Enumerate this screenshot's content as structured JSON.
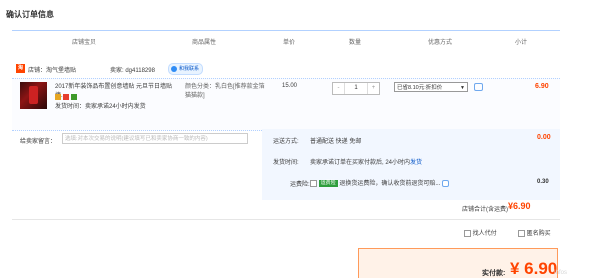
{
  "page": {
    "title": "确认订单信息"
  },
  "columns": [
    "店铺宝贝",
    "商品属性",
    "单价",
    "数量",
    "优惠方式",
    "小计"
  ],
  "shop": {
    "icon_text": "淘",
    "name": "店铺：淘气堡墙贴",
    "seller": "卖家: dg4118298",
    "contact_label": "和我联系"
  },
  "item": {
    "name": "2017新年装饰品布置创意墙贴 元旦节日墙贴墙...",
    "shipping": "发货时间：卖家承诺24小时内发货",
    "sku": "颜色分类：乳白色[推荐款金箔猫猫款]",
    "price": "15.00",
    "quantity": "1",
    "minus": "-",
    "plus": "+",
    "promo": "已省8.10元:折扣价",
    "subtotal": "6.90"
  },
  "message": {
    "label": "给卖家留言：",
    "placeholder": "选填:对本次交易的说明(建议填写已和卖家协商一致的内容)"
  },
  "delivery": {
    "method_label": "运送方式:",
    "method_value": "普通配送 快递 免邮",
    "method_fee": "0.00",
    "time_label": "发货时间:",
    "time_value": "卖家承诺订单在买家付款后, 24小时内",
    "time_link": "发货",
    "insurance_label": "运费险:",
    "insurance_tag": "运费险",
    "insurance_text": "退换货运费险，确认收货前退货可赔...",
    "insurance_fee": "0.30"
  },
  "total": {
    "label": "店铺合计(含运费)",
    "value": "¥6.90"
  },
  "options": {
    "anon_label": "匿名购买",
    "proxy_label": "找人代付"
  },
  "payment": {
    "label": "实付款:",
    "value": "¥ 6.90"
  },
  "watermark": "Infos"
}
